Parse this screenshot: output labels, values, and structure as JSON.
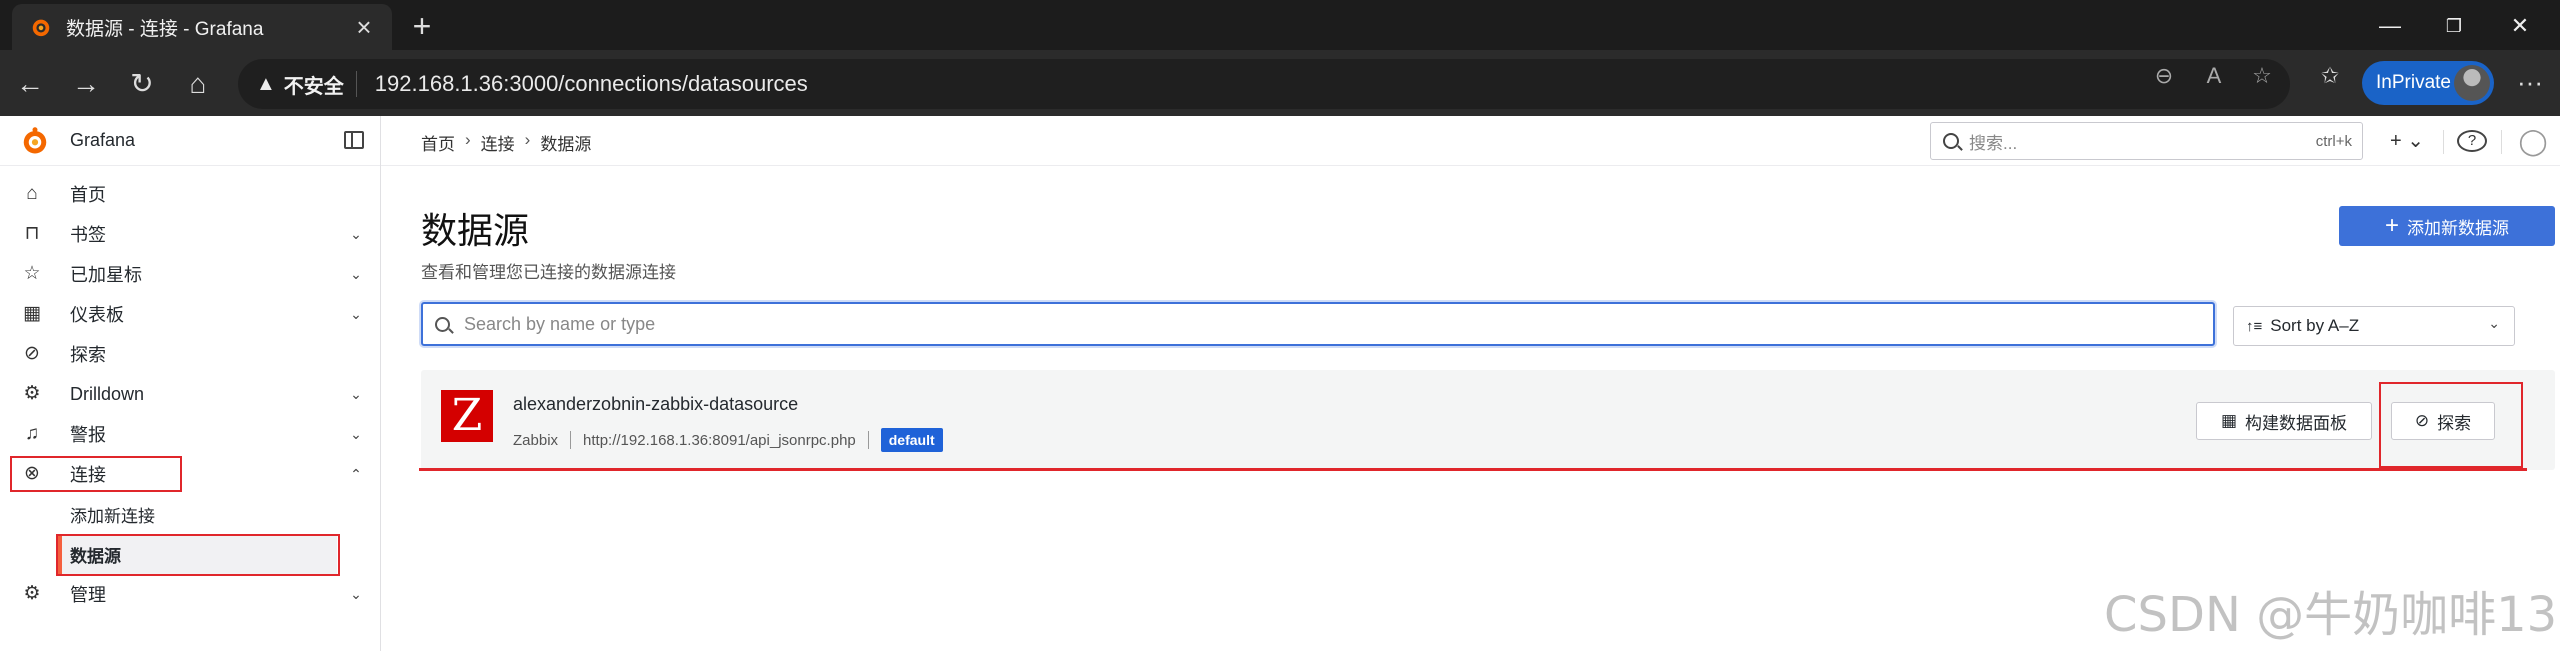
{
  "browser": {
    "tab_title": "数据源 - 连接 - Grafana",
    "new_tab": "+",
    "window_controls": {
      "minimize": "—",
      "maximize": "❐",
      "close": "✕"
    },
    "security_label": "不安全",
    "url": "192.168.1.36:3000/connections/datasources",
    "inprivate_label": "InPrivate",
    "menu": "···"
  },
  "sidebar": {
    "brand": "Grafana",
    "items": [
      {
        "label": "首页",
        "icon": "home-icon",
        "glyph": "⌂",
        "expand": ""
      },
      {
        "label": "书签",
        "icon": "bookmark-icon",
        "glyph": "⊓",
        "expand": "⌄"
      },
      {
        "label": "已加星标",
        "icon": "star-icon",
        "glyph": "☆",
        "expand": "⌄"
      },
      {
        "label": "仪表板",
        "icon": "apps-icon",
        "glyph": "▦",
        "expand": "⌄"
      },
      {
        "label": "探索",
        "icon": "compass-icon",
        "glyph": "⊘",
        "expand": ""
      },
      {
        "label": "Drilldown",
        "icon": "drilldown-icon",
        "glyph": "⚙",
        "expand": "⌄"
      },
      {
        "label": "警报",
        "icon": "bell-icon",
        "glyph": "♫",
        "expand": "⌄"
      },
      {
        "label": "连接",
        "icon": "link-icon",
        "glyph": "⊗",
        "expand": "⌃"
      },
      {
        "label": "添加新连接",
        "icon": "",
        "glyph": "",
        "expand": ""
      },
      {
        "label": "数据源",
        "icon": "",
        "glyph": "",
        "expand": ""
      },
      {
        "label": "管理",
        "icon": "cog-icon",
        "glyph": "⚙",
        "expand": "⌄"
      }
    ]
  },
  "topbar": {
    "breadcrumb": [
      "首页",
      "连接",
      "数据源"
    ],
    "breadcrumb_sep": "›",
    "search_placeholder": "搜索...",
    "search_shortcut": "ctrl+k",
    "new_button": "+ ⌄",
    "help": "?",
    "profile": "◯"
  },
  "main": {
    "title": "数据源",
    "subtitle": "查看和管理您已连接的数据源连接",
    "add_button": "添加新数据源",
    "filter_placeholder": "Search by name or type",
    "sort_label": "Sort by A–Z",
    "datasources": [
      {
        "logo_letter": "Z",
        "name": "alexanderzobnin-zabbix-datasource",
        "type": "Zabbix",
        "url": "http://192.168.1.36:8091/api_jsonrpc.php",
        "badge": "default",
        "build_dashboard_label": "构建数据面板",
        "explore_label": "探索"
      }
    ]
  },
  "watermark": "CSDN @牛奶咖啡13",
  "colors": {
    "accent_blue": "#3d71d9",
    "highlight_red": "#e0262b",
    "grafana_orange": "#f55f3e",
    "zabbix_red": "#d40000"
  }
}
